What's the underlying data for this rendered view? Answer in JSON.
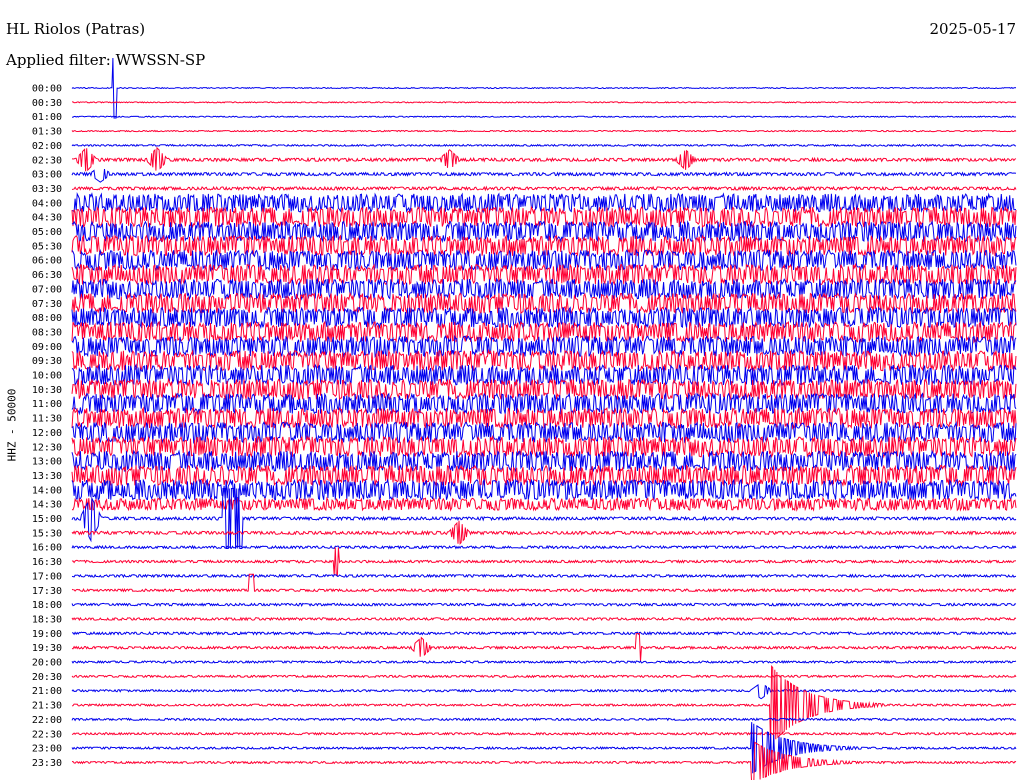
{
  "header": {
    "title": "HL Riolos (Patras)",
    "date": "2025-05-17",
    "filter": "Applied filter: WWSSN-SP"
  },
  "colors": {
    "blue": "#0000ee",
    "red": "#ff0033"
  },
  "chart_data": {
    "type": "line",
    "title": "HL Riolos (Patras)",
    "ylabel": "HHZ - 50000",
    "xlabel": "",
    "grid": false,
    "legend": "none",
    "series_colors_alternating": [
      "blue",
      "red"
    ],
    "rows": [
      {
        "label": "00:00",
        "color": "blue",
        "amp": 0.5
      },
      {
        "label": "00:30",
        "color": "red",
        "amp": 0.5
      },
      {
        "label": "01:00",
        "color": "blue",
        "amp": 0.5
      },
      {
        "label": "01:30",
        "color": "red",
        "amp": 0.6
      },
      {
        "label": "02:00",
        "color": "blue",
        "amp": 0.8
      },
      {
        "label": "02:30",
        "color": "red",
        "amp": 1.5
      },
      {
        "label": "03:00",
        "color": "blue",
        "amp": 1.5
      },
      {
        "label": "03:30",
        "color": "red",
        "amp": 1.5
      },
      {
        "label": "04:00",
        "color": "blue",
        "amp": 9
      },
      {
        "label": "04:30",
        "color": "red",
        "amp": 10
      },
      {
        "label": "05:00",
        "color": "blue",
        "amp": 10
      },
      {
        "label": "05:30",
        "color": "red",
        "amp": 10
      },
      {
        "label": "06:00",
        "color": "blue",
        "amp": 10
      },
      {
        "label": "06:30",
        "color": "red",
        "amp": 10
      },
      {
        "label": "07:00",
        "color": "blue",
        "amp": 10
      },
      {
        "label": "07:30",
        "color": "red",
        "amp": 10
      },
      {
        "label": "08:00",
        "color": "blue",
        "amp": 10
      },
      {
        "label": "08:30",
        "color": "red",
        "amp": 10
      },
      {
        "label": "09:00",
        "color": "blue",
        "amp": 10
      },
      {
        "label": "09:30",
        "color": "red",
        "amp": 10
      },
      {
        "label": "10:00",
        "color": "blue",
        "amp": 10
      },
      {
        "label": "10:30",
        "color": "red",
        "amp": 10
      },
      {
        "label": "11:00",
        "color": "blue",
        "amp": 10
      },
      {
        "label": "11:30",
        "color": "red",
        "amp": 10
      },
      {
        "label": "12:00",
        "color": "blue",
        "amp": 10
      },
      {
        "label": "12:30",
        "color": "red",
        "amp": 10
      },
      {
        "label": "13:00",
        "color": "blue",
        "amp": 10
      },
      {
        "label": "13:30",
        "color": "red",
        "amp": 10
      },
      {
        "label": "14:00",
        "color": "blue",
        "amp": 10
      },
      {
        "label": "14:30",
        "color": "red",
        "amp": 6
      },
      {
        "label": "15:00",
        "color": "blue",
        "amp": 1.5
      },
      {
        "label": "15:30",
        "color": "red",
        "amp": 1.5
      },
      {
        "label": "16:00",
        "color": "blue",
        "amp": 1.2
      },
      {
        "label": "16:30",
        "color": "red",
        "amp": 1.2
      },
      {
        "label": "17:00",
        "color": "blue",
        "amp": 1.2
      },
      {
        "label": "17:30",
        "color": "red",
        "amp": 1.2
      },
      {
        "label": "18:00",
        "color": "blue",
        "amp": 1.2
      },
      {
        "label": "18:30",
        "color": "red",
        "amp": 1.2
      },
      {
        "label": "19:00",
        "color": "blue",
        "amp": 1.2
      },
      {
        "label": "19:30",
        "color": "red",
        "amp": 1.2
      },
      {
        "label": "20:00",
        "color": "blue",
        "amp": 1.0
      },
      {
        "label": "20:30",
        "color": "red",
        "amp": 1.0
      },
      {
        "label": "21:00",
        "color": "blue",
        "amp": 1.0
      },
      {
        "label": "21:30",
        "color": "red",
        "amp": 1.0
      },
      {
        "label": "22:00",
        "color": "blue",
        "amp": 1.0
      },
      {
        "label": "22:30",
        "color": "red",
        "amp": 1.0
      },
      {
        "label": "23:00",
        "color": "blue",
        "amp": 1.0
      },
      {
        "label": "23:30",
        "color": "red",
        "amp": 1.0
      }
    ],
    "events": [
      {
        "row": 0,
        "t": 0.045,
        "height": 30,
        "type": "spike"
      },
      {
        "row": 5,
        "t": 0.015,
        "height": 12,
        "type": "burst"
      },
      {
        "row": 5,
        "t": 0.09,
        "height": 12,
        "type": "burst"
      },
      {
        "row": 5,
        "t": 0.4,
        "height": 10,
        "type": "burst"
      },
      {
        "row": 5,
        "t": 0.65,
        "height": 10,
        "type": "burst"
      },
      {
        "row": 6,
        "t": 0.03,
        "height": 8,
        "type": "burst"
      },
      {
        "row": 30,
        "t": 0.02,
        "height": 22,
        "type": "burst"
      },
      {
        "row": 30,
        "t": 0.16,
        "height": 30,
        "type": "block"
      },
      {
        "row": 31,
        "t": 0.41,
        "height": 12,
        "type": "burst"
      },
      {
        "row": 33,
        "t": 0.28,
        "height": 14,
        "type": "spike"
      },
      {
        "row": 35,
        "t": 0.19,
        "height": 16,
        "type": "spike"
      },
      {
        "row": 39,
        "t": 0.37,
        "height": 10,
        "type": "burst"
      },
      {
        "row": 39,
        "t": 0.6,
        "height": 14,
        "type": "spike"
      },
      {
        "row": 42,
        "t": 0.73,
        "height": 8,
        "type": "burst"
      },
      {
        "row": 43,
        "t": 0.74,
        "height": 40,
        "type": "quake"
      },
      {
        "row": 46,
        "t": 0.72,
        "height": 26,
        "type": "quake"
      },
      {
        "row": 47,
        "t": 0.72,
        "height": 22,
        "type": "quake"
      }
    ]
  }
}
